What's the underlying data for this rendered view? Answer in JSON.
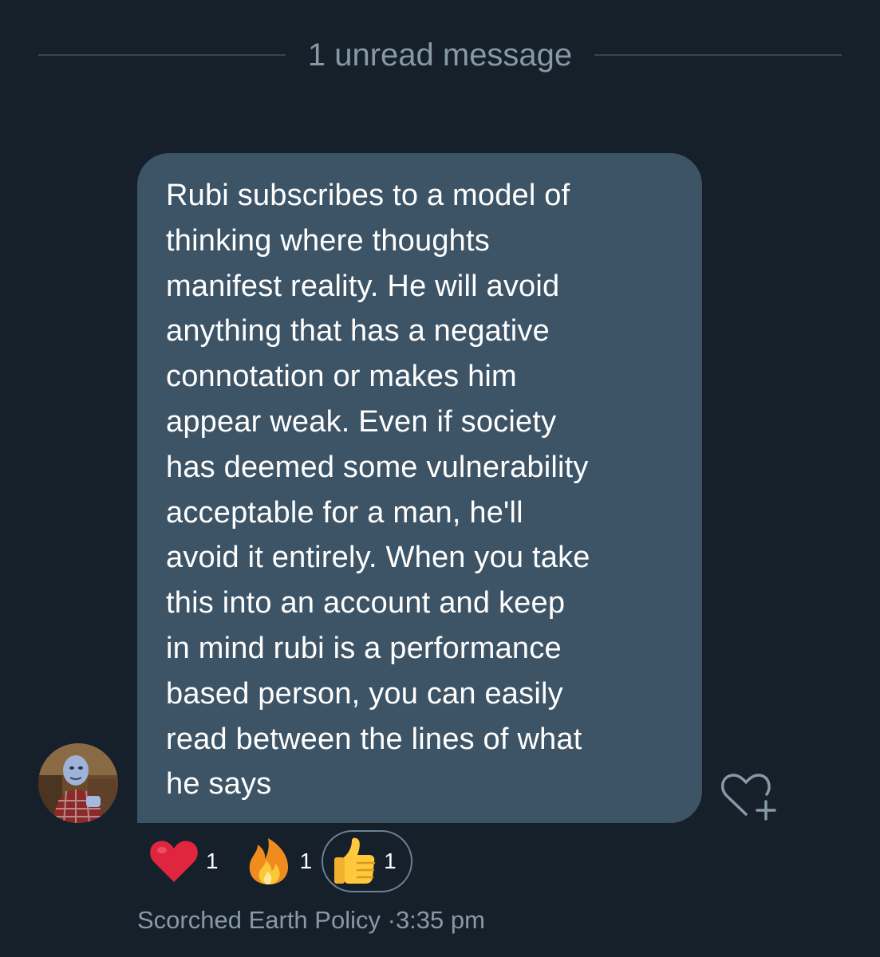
{
  "divider": {
    "label": "1 unread message"
  },
  "message": {
    "lines": [
      "Rubi subscribes to a model of",
      "thinking where thoughts",
      "manifest reality. He will avoid",
      "anything that has a negative",
      "connotation or makes him",
      "appear weak. Even if society",
      "has deemed some vulnerability",
      "acceptable for a man, he'll",
      "avoid it entirely. When you take",
      "this into an account and keep",
      "in mind rubi is a performance",
      "based person, you can easily",
      "read between the lines of what",
      "he says"
    ],
    "sender": "Scorched Earth Policy",
    "separator": "·",
    "time": "3:35 pm"
  },
  "reactions": [
    {
      "icon": "red-heart-icon",
      "count": "1",
      "selected": false
    },
    {
      "icon": "fire-icon",
      "count": "1",
      "selected": false
    },
    {
      "icon": "thumbs-up-icon",
      "count": "1",
      "selected": true
    }
  ],
  "actions": {
    "add_reaction_icon": "heart-plus-icon"
  },
  "colors": {
    "background": "#15202b",
    "bubble": "#3d5466",
    "muted_text": "#8899a6",
    "divider_line": "#38444d"
  }
}
